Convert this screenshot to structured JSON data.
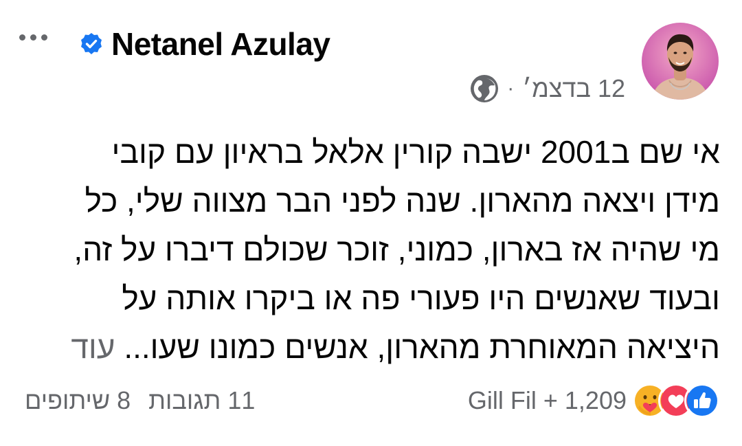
{
  "header": {
    "author_name": "Netanel Azulay",
    "date": "12 בדצמ׳",
    "separator": "·",
    "more_icon": "more-horizontal-icon",
    "verified_icon": "verified-badge-icon",
    "privacy_icon": "globe-icon"
  },
  "post": {
    "lines": [
      "אי שם ב2001 ישבה קורין אלאל בראיון עם קובי",
      "מידן ויצאה מהארון. שנה לפני הבר מצווה שלי, כל",
      "מי שהיה אז בארון, כמוני, זוכר שכולם דיברו על זה,",
      "ובעוד שאנשים היו פעורי פה או ביקרו אותה על"
    ],
    "last_line_text": "היציאה המאוחרת מהארון, אנשים כמונו שעו...",
    "see_more": "עוד"
  },
  "footer": {
    "reaction_icons": [
      "like-icon",
      "love-icon",
      "care-icon"
    ],
    "reaction_summary": "Gill Fil + 1,209",
    "comments": "11 תגובות",
    "shares": "8 שיתופים"
  },
  "colors": {
    "text_primary": "#050505",
    "text_secondary": "#65676b",
    "verified_blue": "#1877f2",
    "like_blue": "#1877f2",
    "love_red": "#f33e58",
    "care_yellow": "#f7b125"
  }
}
